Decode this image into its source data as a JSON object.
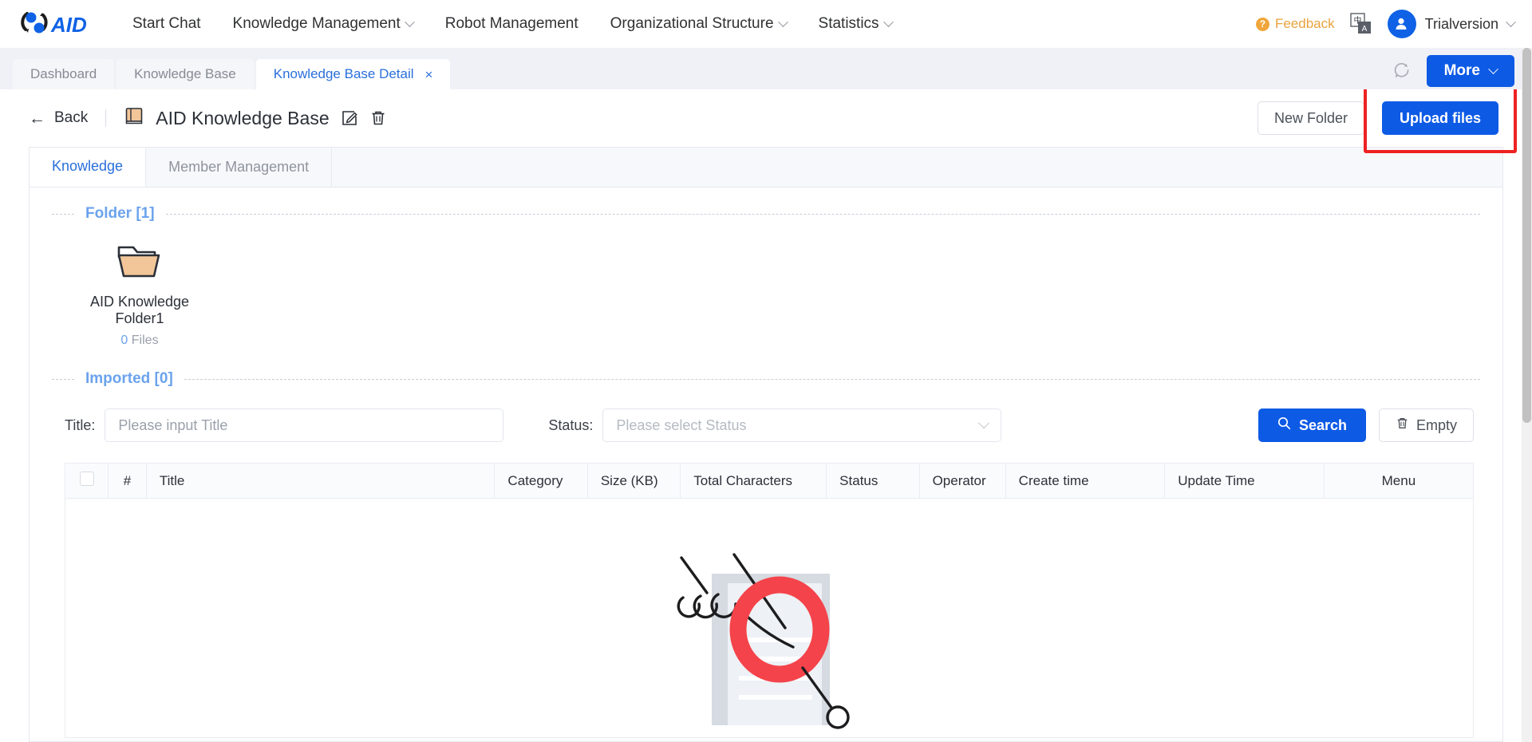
{
  "navbar": {
    "brand": "AID",
    "items": [
      {
        "label": "Start Chat",
        "has_caret": false
      },
      {
        "label": "Knowledge Management",
        "has_caret": true
      },
      {
        "label": "Robot Management",
        "has_caret": false
      },
      {
        "label": "Organizational Structure",
        "has_caret": true
      },
      {
        "label": "Statistics",
        "has_caret": true
      }
    ],
    "feedback_label": "Feedback",
    "language_icon": "translate-icon",
    "user_name": "Trialversion"
  },
  "tabstrip": {
    "tabs": [
      {
        "label": "Dashboard",
        "active": false,
        "closable": false
      },
      {
        "label": "Knowledge Base",
        "active": false,
        "closable": false
      },
      {
        "label": "Knowledge Base Detail",
        "active": true,
        "closable": true,
        "close_glyph": "×"
      }
    ],
    "refresh_icon": "refresh-icon",
    "more_label": "More"
  },
  "detail_header": {
    "back_label": "Back",
    "back_icon": "arrow-left-icon",
    "book_icon": "book-icon",
    "title": "AID Knowledge Base",
    "edit_icon": "edit-icon",
    "delete_icon": "trash-icon",
    "new_folder_label": "New Folder",
    "upload_label": "Upload files",
    "highlight_color": "#ee2222"
  },
  "inner_tabs": [
    {
      "label": "Knowledge",
      "active": true
    },
    {
      "label": "Member Management",
      "active": false
    }
  ],
  "folder_section": {
    "title": "Folder [1]",
    "items": [
      {
        "name": "AID Knowledge Folder1",
        "count": "0",
        "count_unit": "Files",
        "icon": "folder-icon"
      }
    ]
  },
  "imported_section": {
    "title": "Imported [0]"
  },
  "filters": {
    "title_label": "Title:",
    "title_placeholder": "Please input Title",
    "title_value": "",
    "status_label": "Status:",
    "status_placeholder": "Please select Status",
    "status_value": "",
    "search_label": "Search",
    "search_icon": "search-icon",
    "empty_label": "Empty",
    "empty_icon": "trash-icon"
  },
  "table": {
    "columns": [
      {
        "key": "checkbox",
        "label": ""
      },
      {
        "key": "index",
        "label": "#"
      },
      {
        "key": "title",
        "label": "Title"
      },
      {
        "key": "category",
        "label": "Category"
      },
      {
        "key": "size",
        "label": "Size (KB)"
      },
      {
        "key": "total_characters",
        "label": "Total Characters"
      },
      {
        "key": "status",
        "label": "Status"
      },
      {
        "key": "operator",
        "label": "Operator"
      },
      {
        "key": "create_time",
        "label": "Create time"
      },
      {
        "key": "update_time",
        "label": "Update Time"
      },
      {
        "key": "menu",
        "label": "Menu"
      }
    ],
    "rows": [],
    "empty_illustration": "hand-magnifier-document-illustration"
  },
  "colors": {
    "primary_blue": "#0d5ae5",
    "link_blue": "#2a6fdb",
    "section_blue": "#6ba3ec",
    "feedback_orange": "#e8a33d",
    "highlight_red": "#ee2222"
  }
}
